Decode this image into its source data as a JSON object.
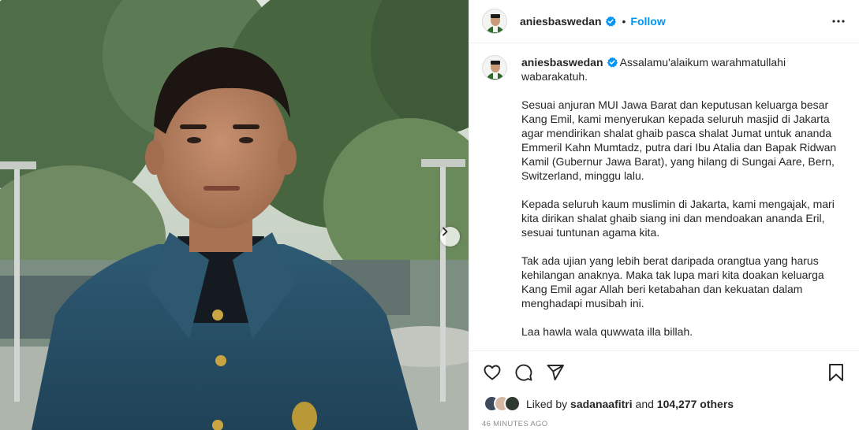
{
  "post": {
    "image_alt": "Photo of a young man in a blue jacket",
    "next_label": "Next"
  },
  "header": {
    "username": "aniesbaswedan",
    "dot": "•",
    "follow_label": "Follow",
    "more_icon": "more-horizontal-icon"
  },
  "caption": {
    "username": "aniesbaswedan",
    "first_line": "Assalamu'alaikum warahmatullahi wabarakatuh.",
    "paragraphs": [
      "Sesuai anjuran MUI Jawa Barat dan keputusan keluarga besar Kang Emil, kami menyerukan kepada seluruh masjid di Jakarta agar mendirikan shalat ghaib pasca shalat Jumat untuk ananda Emmeril Kahn Mumtadz, putra dari Ibu Atalia dan Bapak Ridwan Kamil (Gubernur Jawa Barat), yang hilang di Sungai Aare, Bern, Switzerland, minggu lalu.",
      "Kepada seluruh kaum muslimin di Jakarta, kami mengajak, mari kita dirikan shalat ghaib siang ini dan mendoakan ananda Eril, sesuai tuntunan agama kita.",
      "Tak ada ujian yang lebih berat daripada orangtua yang harus kehilangan anaknya. Maka tak lupa mari kita doakan keluarga Kang Emil agar Allah beri ketabahan dan kekuatan dalam menghadapi musibah ini.",
      "Laa hawla wala quwwata illa billah."
    ]
  },
  "actions": {
    "like_icon": "heart-icon",
    "comment_icon": "comment-icon",
    "share_icon": "paper-plane-icon",
    "save_icon": "bookmark-icon"
  },
  "likes": {
    "prefix": "Liked by",
    "user": "sadanaafitri",
    "middle": "and",
    "others": "104,277 others"
  },
  "timestamp": "46 MINUTES AGO",
  "colors": {
    "accent": "#0095f6",
    "verified": "#0095f6",
    "text": "#262626",
    "muted": "#8e8e8e"
  }
}
